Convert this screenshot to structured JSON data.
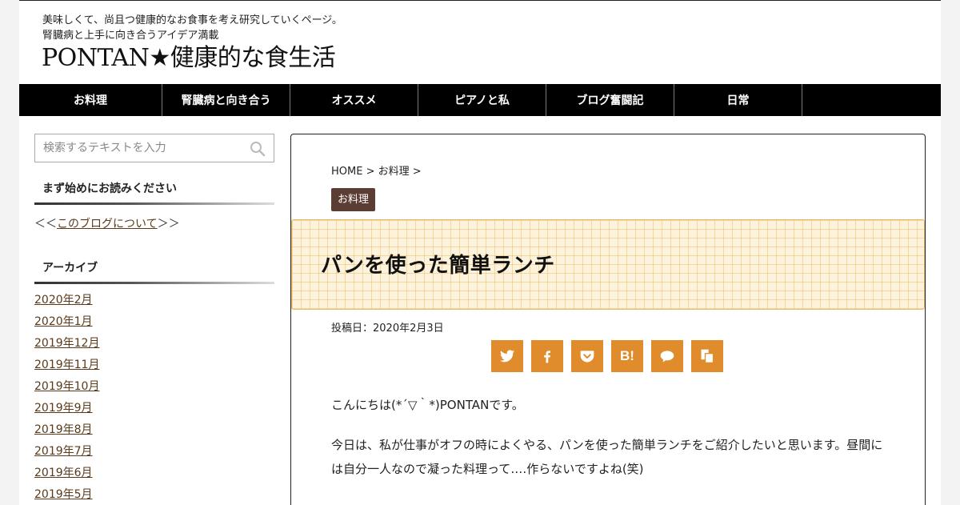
{
  "header": {
    "tagline_1": "美味しくて、尚且つ健康的なお食事を考え研究していくページ。",
    "tagline_2": "腎臓病と上手に向き合うアイデア満載",
    "site_title": "PONTAN★健康的な食生活"
  },
  "nav": {
    "items": [
      {
        "label": "お料理"
      },
      {
        "label": "腎臓病と向き合う"
      },
      {
        "label": "オススメ"
      },
      {
        "label": "ピアノと私"
      },
      {
        "label": "ブログ奮闘記"
      },
      {
        "label": "日常"
      }
    ]
  },
  "sidebar": {
    "search": {
      "placeholder": "検索するテキストを入力",
      "icon": "search-icon"
    },
    "widget1": {
      "title": "まず始めにお読みください",
      "prefix": "＜＜",
      "link": "このブログについて",
      "suffix": "＞＞"
    },
    "widget2": {
      "title": "アーカイブ",
      "items": [
        "2020年2月",
        "2020年1月",
        "2019年12月",
        "2019年11月",
        "2019年10月",
        "2019年9月",
        "2019年8月",
        "2019年7月",
        "2019年6月",
        "2019年5月"
      ]
    }
  },
  "article": {
    "breadcrumb": {
      "home": "HOME",
      "sep": " > ",
      "category": "お料理",
      "trail": " >"
    },
    "category_badge": "お料理",
    "title": "パンを使った簡単ランチ",
    "date": "投稿日：2020年2月3日",
    "share": {
      "color": "#e08c2c",
      "buttons": [
        "twitter-icon",
        "facebook-icon",
        "pocket-icon",
        "hatena-icon",
        "line-icon",
        "copy-icon"
      ],
      "hatena_label": "B!"
    },
    "paragraphs": [
      "こんにちは(*´▽｀*)PONTANです。",
      "今日は、私が仕事がオフの時によくやる、パンを使った簡単ランチをご紹介したいと思います。昼間には自分一人なので凝った料理って‥‥作らないですよね(笑)"
    ]
  },
  "colors": {
    "nav_bg": "#000000",
    "badge_bg": "#5c3d33",
    "link": "#5a3a1a",
    "share_bg": "#e08c2c",
    "banner_bg": "#fdf3dc"
  }
}
